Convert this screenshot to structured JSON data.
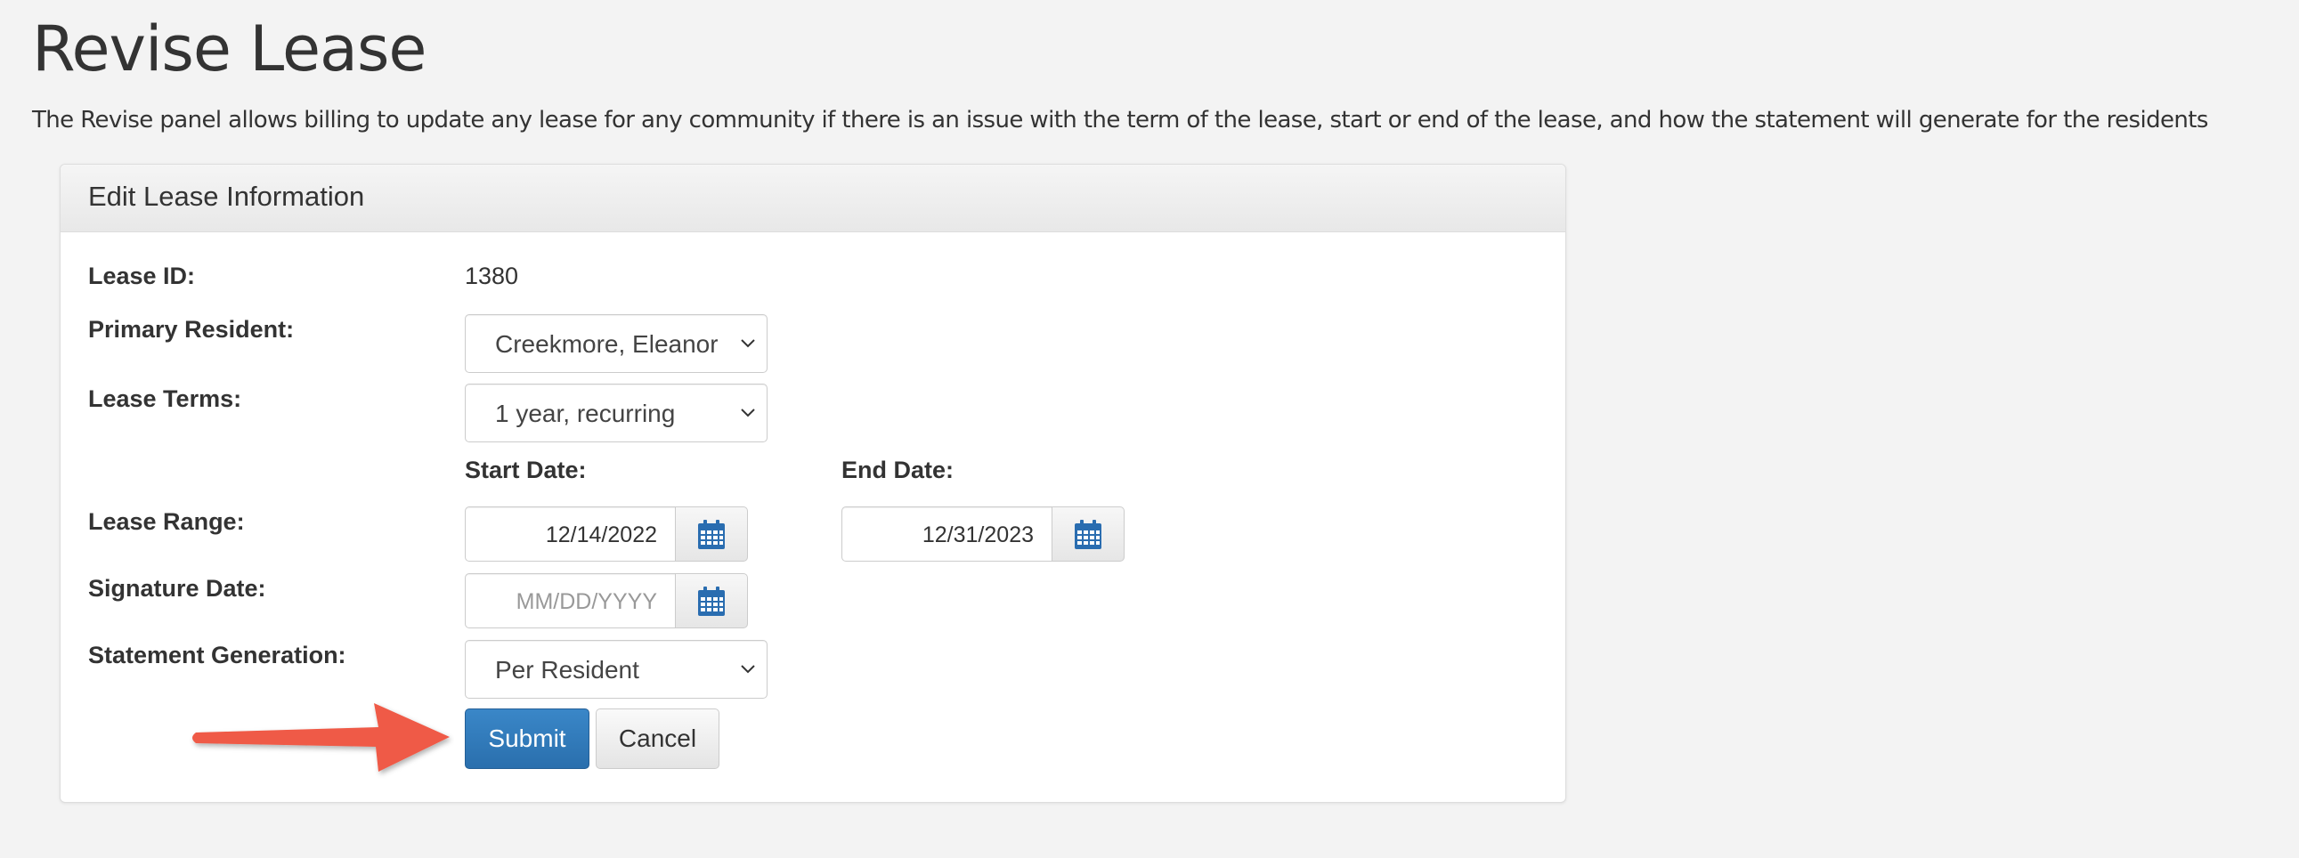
{
  "page": {
    "title": "Revise Lease",
    "description": "The Revise panel allows billing to update any lease for any community if there is an issue with the term of the lease, start or end of the lease, and how the statement will generate for the residents"
  },
  "panel": {
    "title": "Edit Lease Information",
    "lease_id_label": "Lease ID:",
    "lease_id_value": "1380",
    "primary_resident_label": "Primary Resident:",
    "primary_resident_value": "Creekmore, Eleanor",
    "lease_terms_label": "Lease Terms:",
    "lease_terms_value": "1 year, recurring",
    "start_date_label": "Start Date:",
    "end_date_label": "End Date:",
    "lease_range_label": "Lease Range:",
    "start_date_value": "12/14/2022",
    "end_date_value": "12/31/2023",
    "signature_date_label": "Signature Date:",
    "signature_date_placeholder": "MM/DD/YYYY",
    "statement_generation_label": "Statement Generation:",
    "statement_generation_value": "Per Resident",
    "submit_label": "Submit",
    "cancel_label": "Cancel"
  },
  "icons": {
    "calendar": "calendar-icon",
    "dropdown": "chevron-down-icon",
    "annotation": "arrow-right-icon"
  },
  "colors": {
    "primary": "#2d74b4",
    "calendar_icon": "#2a6db0",
    "annotation_arrow": "#ef5a46",
    "background": "#f3f3f3"
  }
}
